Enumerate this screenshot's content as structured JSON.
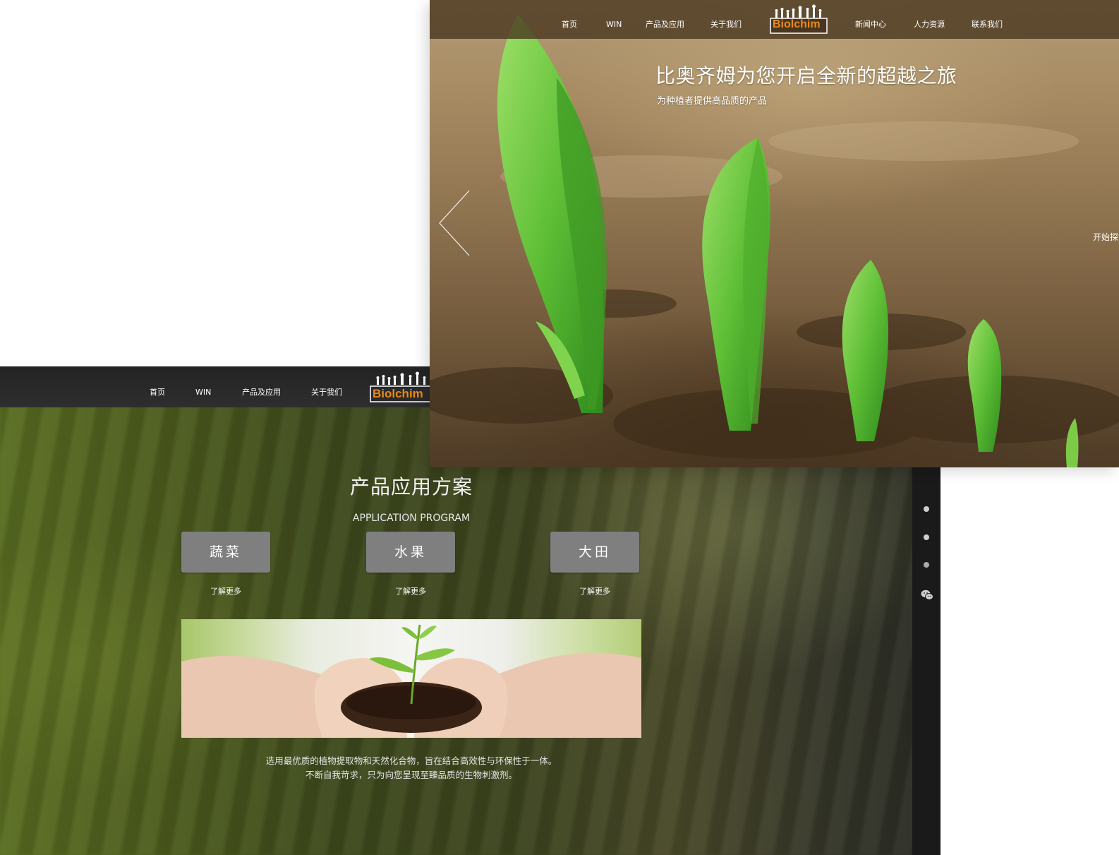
{
  "back_page": {
    "nav": {
      "items": [
        "首页",
        "WIN",
        "产品及应用",
        "关于我们"
      ],
      "logo_text": "Biolchim"
    },
    "section": {
      "title": "产品应用方案",
      "subtitle": "APPLICATION PROGRAM"
    },
    "categories": [
      {
        "label": "蔬菜",
        "more": "了解更多"
      },
      {
        "label": "水果",
        "more": "了解更多"
      },
      {
        "label": "大田",
        "more": "了解更多"
      }
    ],
    "description": [
      "选用最优质的植物提取物和天然化合物，旨在结合高效性与环保性于一体。",
      "不断自我苛求，只为向您呈现至臻品质的生物刺激剂。"
    ],
    "side_rail": {
      "icons": [
        "dot-icon",
        "dot-icon",
        "dot-icon",
        "wechat-icon"
      ]
    }
  },
  "front_page": {
    "nav": {
      "items_left": [
        "首页",
        "WIN",
        "产品及应用",
        "关于我们"
      ],
      "logo_text": "Biolchim",
      "items_right": [
        "新闻中心",
        "人力资源",
        "联系我们"
      ]
    },
    "hero": {
      "title": "比奥齐姆为您开启全新的超越之旅",
      "subtitle": "为种植者提供高品质的产品",
      "cta": "开始探索"
    }
  },
  "colors": {
    "brand_orange": "#e88a1a",
    "nav_dark": "#2a2a2a",
    "button_gray": "#7f7f7f",
    "rail_dark": "#1a1a1a"
  }
}
